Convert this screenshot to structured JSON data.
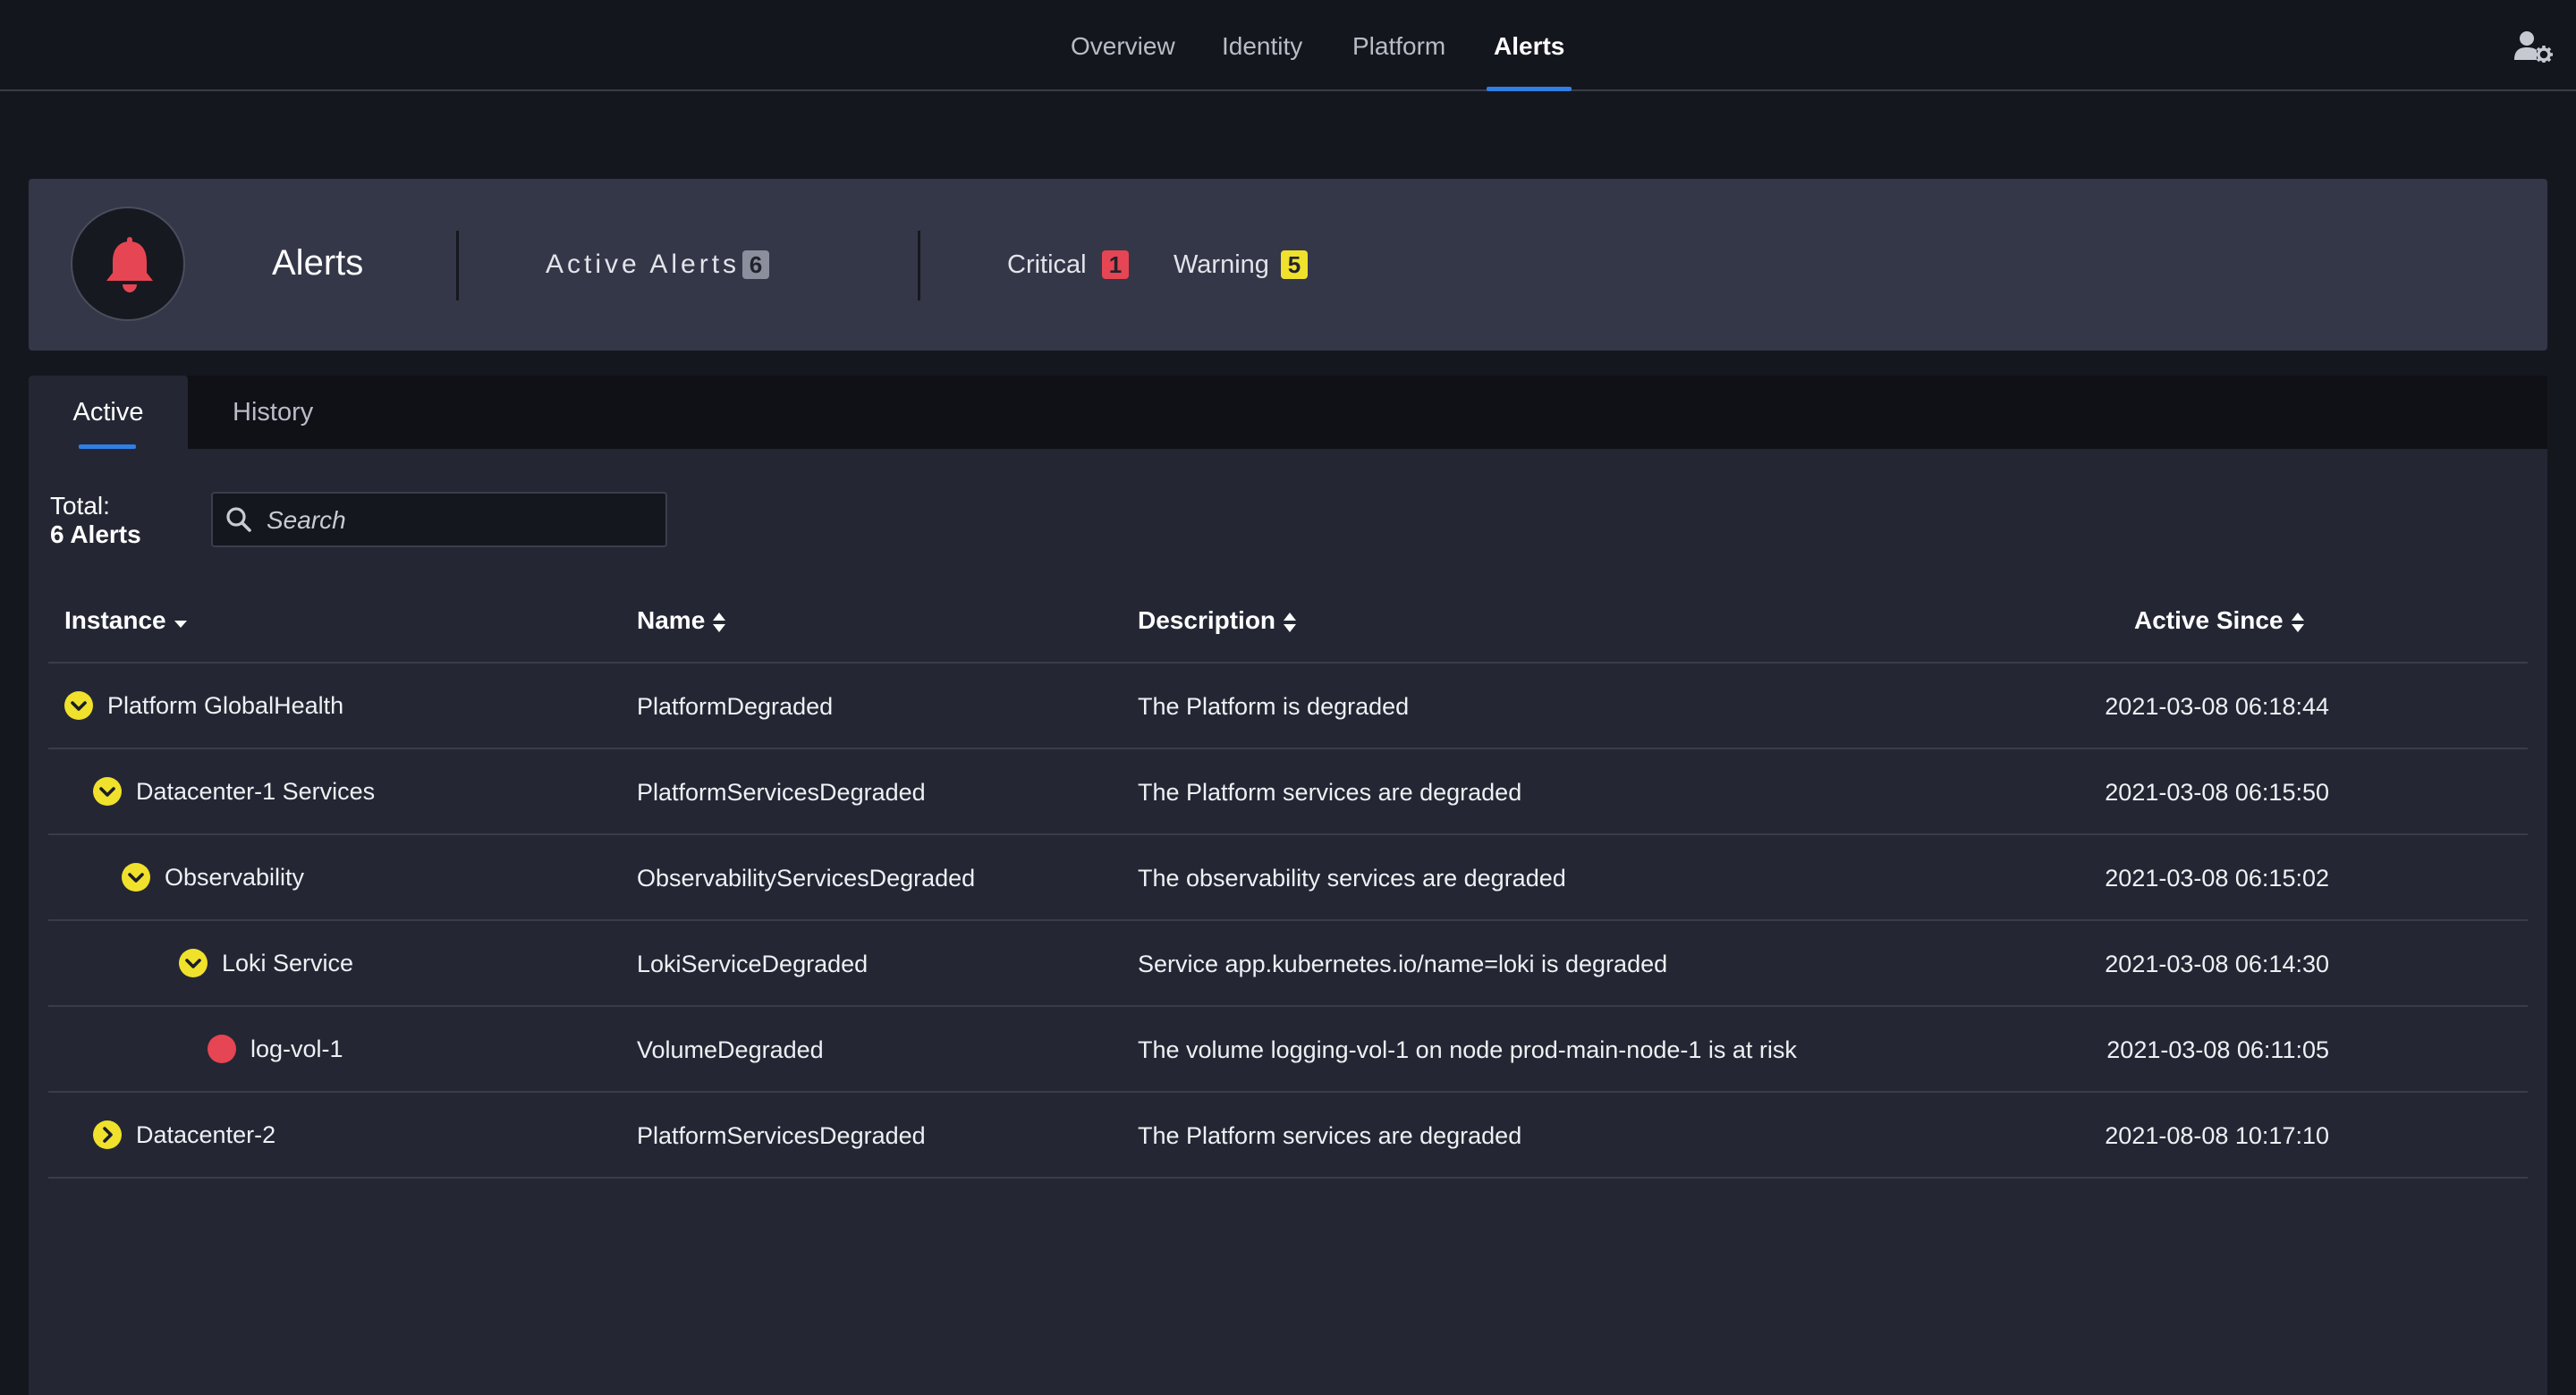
{
  "nav": {
    "tabs": [
      {
        "label": "Overview"
      },
      {
        "label": "Identity"
      },
      {
        "label": "Platform"
      },
      {
        "label": "Alerts"
      }
    ],
    "active": "Alerts",
    "user_icon": "user-settings-icon"
  },
  "header": {
    "icon": "bell-icon",
    "title": "Alerts",
    "active_alerts_label": "Active Alerts",
    "active_alerts_count": "6",
    "critical_label": "Critical",
    "critical_count": "1",
    "warning_label": "Warning",
    "warning_count": "5"
  },
  "tabs": {
    "active": "Active",
    "history": "History"
  },
  "summary": {
    "total_label": "Total:",
    "total_count": "6 Alerts"
  },
  "search": {
    "placeholder": "Search"
  },
  "table": {
    "columns": {
      "instance": "Instance",
      "name": "Name",
      "description": "Description",
      "active_since": "Active Since"
    },
    "rows": [
      {
        "instance": "Platform GlobalHealth",
        "depth": 0,
        "status": "warning-expanded",
        "name": "PlatformDegraded",
        "description": "The Platform is degraded",
        "active_since": "2021-03-08 06:18:44"
      },
      {
        "instance": "Datacenter-1 Services",
        "depth": 1,
        "status": "warning-expanded",
        "name": "PlatformServicesDegraded",
        "description": "The Platform services are degraded",
        "active_since": "2021-03-08 06:15:50"
      },
      {
        "instance": "Observability",
        "depth": 2,
        "status": "warning-expanded",
        "name": "ObservabilityServicesDegraded",
        "description": "The observability services are degraded",
        "active_since": "2021-03-08 06:15:02"
      },
      {
        "instance": "Loki Service",
        "depth": 3,
        "status": "warning-expanded",
        "name": "LokiServiceDegraded",
        "description": "Service app.kubernetes.io/name=loki is degraded",
        "active_since": "2021-03-08 06:14:30"
      },
      {
        "instance": "log-vol-1",
        "depth": 4,
        "status": "critical",
        "name": "VolumeDegraded",
        "description": "The volume logging-vol-1 on node prod-main-node-1 is at risk",
        "active_since": "2021-03-08 06:11:05"
      },
      {
        "instance": "Datacenter-2",
        "depth": 1,
        "status": "warning-collapsed",
        "name": "PlatformServicesDegraded",
        "description": "The Platform services are degraded",
        "active_since": "2021-08-08 10:17:10"
      }
    ]
  },
  "colors": {
    "accent": "#2f7fe6",
    "critical": "#e64553",
    "warning": "#f0e12c",
    "panel": "#343748",
    "background": "#15171f"
  }
}
